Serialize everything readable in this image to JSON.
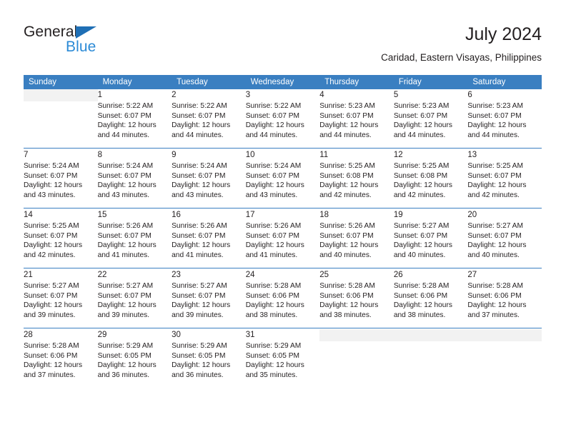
{
  "brand": {
    "name_part1": "General",
    "name_part2": "Blue",
    "triangle_color": "#1f6fb5",
    "blue_color": "#2b8ad6"
  },
  "header": {
    "title": "July 2024",
    "subtitle": "Caridad, Eastern Visayas, Philippines"
  },
  "theme": {
    "header_bg": "#3a7fc1",
    "daynum_bg": "#f2f2f2",
    "text": "#231f20"
  },
  "calendar": {
    "weekday_headers": [
      "Sunday",
      "Monday",
      "Tuesday",
      "Wednesday",
      "Thursday",
      "Friday",
      "Saturday"
    ],
    "weeks": [
      [
        {
          "day": "",
          "sunrise": "",
          "sunset": "",
          "daylight1": "",
          "daylight2": ""
        },
        {
          "day": "1",
          "sunrise": "Sunrise: 5:22 AM",
          "sunset": "Sunset: 6:07 PM",
          "daylight1": "Daylight: 12 hours",
          "daylight2": "and 44 minutes."
        },
        {
          "day": "2",
          "sunrise": "Sunrise: 5:22 AM",
          "sunset": "Sunset: 6:07 PM",
          "daylight1": "Daylight: 12 hours",
          "daylight2": "and 44 minutes."
        },
        {
          "day": "3",
          "sunrise": "Sunrise: 5:22 AM",
          "sunset": "Sunset: 6:07 PM",
          "daylight1": "Daylight: 12 hours",
          "daylight2": "and 44 minutes."
        },
        {
          "day": "4",
          "sunrise": "Sunrise: 5:23 AM",
          "sunset": "Sunset: 6:07 PM",
          "daylight1": "Daylight: 12 hours",
          "daylight2": "and 44 minutes."
        },
        {
          "day": "5",
          "sunrise": "Sunrise: 5:23 AM",
          "sunset": "Sunset: 6:07 PM",
          "daylight1": "Daylight: 12 hours",
          "daylight2": "and 44 minutes."
        },
        {
          "day": "6",
          "sunrise": "Sunrise: 5:23 AM",
          "sunset": "Sunset: 6:07 PM",
          "daylight1": "Daylight: 12 hours",
          "daylight2": "and 44 minutes."
        }
      ],
      [
        {
          "day": "7",
          "sunrise": "Sunrise: 5:24 AM",
          "sunset": "Sunset: 6:07 PM",
          "daylight1": "Daylight: 12 hours",
          "daylight2": "and 43 minutes."
        },
        {
          "day": "8",
          "sunrise": "Sunrise: 5:24 AM",
          "sunset": "Sunset: 6:07 PM",
          "daylight1": "Daylight: 12 hours",
          "daylight2": "and 43 minutes."
        },
        {
          "day": "9",
          "sunrise": "Sunrise: 5:24 AM",
          "sunset": "Sunset: 6:07 PM",
          "daylight1": "Daylight: 12 hours",
          "daylight2": "and 43 minutes."
        },
        {
          "day": "10",
          "sunrise": "Sunrise: 5:24 AM",
          "sunset": "Sunset: 6:07 PM",
          "daylight1": "Daylight: 12 hours",
          "daylight2": "and 43 minutes."
        },
        {
          "day": "11",
          "sunrise": "Sunrise: 5:25 AM",
          "sunset": "Sunset: 6:08 PM",
          "daylight1": "Daylight: 12 hours",
          "daylight2": "and 42 minutes."
        },
        {
          "day": "12",
          "sunrise": "Sunrise: 5:25 AM",
          "sunset": "Sunset: 6:08 PM",
          "daylight1": "Daylight: 12 hours",
          "daylight2": "and 42 minutes."
        },
        {
          "day": "13",
          "sunrise": "Sunrise: 5:25 AM",
          "sunset": "Sunset: 6:07 PM",
          "daylight1": "Daylight: 12 hours",
          "daylight2": "and 42 minutes."
        }
      ],
      [
        {
          "day": "14",
          "sunrise": "Sunrise: 5:25 AM",
          "sunset": "Sunset: 6:07 PM",
          "daylight1": "Daylight: 12 hours",
          "daylight2": "and 42 minutes."
        },
        {
          "day": "15",
          "sunrise": "Sunrise: 5:26 AM",
          "sunset": "Sunset: 6:07 PM",
          "daylight1": "Daylight: 12 hours",
          "daylight2": "and 41 minutes."
        },
        {
          "day": "16",
          "sunrise": "Sunrise: 5:26 AM",
          "sunset": "Sunset: 6:07 PM",
          "daylight1": "Daylight: 12 hours",
          "daylight2": "and 41 minutes."
        },
        {
          "day": "17",
          "sunrise": "Sunrise: 5:26 AM",
          "sunset": "Sunset: 6:07 PM",
          "daylight1": "Daylight: 12 hours",
          "daylight2": "and 41 minutes."
        },
        {
          "day": "18",
          "sunrise": "Sunrise: 5:26 AM",
          "sunset": "Sunset: 6:07 PM",
          "daylight1": "Daylight: 12 hours",
          "daylight2": "and 40 minutes."
        },
        {
          "day": "19",
          "sunrise": "Sunrise: 5:27 AM",
          "sunset": "Sunset: 6:07 PM",
          "daylight1": "Daylight: 12 hours",
          "daylight2": "and 40 minutes."
        },
        {
          "day": "20",
          "sunrise": "Sunrise: 5:27 AM",
          "sunset": "Sunset: 6:07 PM",
          "daylight1": "Daylight: 12 hours",
          "daylight2": "and 40 minutes."
        }
      ],
      [
        {
          "day": "21",
          "sunrise": "Sunrise: 5:27 AM",
          "sunset": "Sunset: 6:07 PM",
          "daylight1": "Daylight: 12 hours",
          "daylight2": "and 39 minutes."
        },
        {
          "day": "22",
          "sunrise": "Sunrise: 5:27 AM",
          "sunset": "Sunset: 6:07 PM",
          "daylight1": "Daylight: 12 hours",
          "daylight2": "and 39 minutes."
        },
        {
          "day": "23",
          "sunrise": "Sunrise: 5:27 AM",
          "sunset": "Sunset: 6:07 PM",
          "daylight1": "Daylight: 12 hours",
          "daylight2": "and 39 minutes."
        },
        {
          "day": "24",
          "sunrise": "Sunrise: 5:28 AM",
          "sunset": "Sunset: 6:06 PM",
          "daylight1": "Daylight: 12 hours",
          "daylight2": "and 38 minutes."
        },
        {
          "day": "25",
          "sunrise": "Sunrise: 5:28 AM",
          "sunset": "Sunset: 6:06 PM",
          "daylight1": "Daylight: 12 hours",
          "daylight2": "and 38 minutes."
        },
        {
          "day": "26",
          "sunrise": "Sunrise: 5:28 AM",
          "sunset": "Sunset: 6:06 PM",
          "daylight1": "Daylight: 12 hours",
          "daylight2": "and 38 minutes."
        },
        {
          "day": "27",
          "sunrise": "Sunrise: 5:28 AM",
          "sunset": "Sunset: 6:06 PM",
          "daylight1": "Daylight: 12 hours",
          "daylight2": "and 37 minutes."
        }
      ],
      [
        {
          "day": "28",
          "sunrise": "Sunrise: 5:28 AM",
          "sunset": "Sunset: 6:06 PM",
          "daylight1": "Daylight: 12 hours",
          "daylight2": "and 37 minutes."
        },
        {
          "day": "29",
          "sunrise": "Sunrise: 5:29 AM",
          "sunset": "Sunset: 6:05 PM",
          "daylight1": "Daylight: 12 hours",
          "daylight2": "and 36 minutes."
        },
        {
          "day": "30",
          "sunrise": "Sunrise: 5:29 AM",
          "sunset": "Sunset: 6:05 PM",
          "daylight1": "Daylight: 12 hours",
          "daylight2": "and 36 minutes."
        },
        {
          "day": "31",
          "sunrise": "Sunrise: 5:29 AM",
          "sunset": "Sunset: 6:05 PM",
          "daylight1": "Daylight: 12 hours",
          "daylight2": "and 35 minutes."
        },
        {
          "day": "",
          "sunrise": "",
          "sunset": "",
          "daylight1": "",
          "daylight2": ""
        },
        {
          "day": "",
          "sunrise": "",
          "sunset": "",
          "daylight1": "",
          "daylight2": ""
        },
        {
          "day": "",
          "sunrise": "",
          "sunset": "",
          "daylight1": "",
          "daylight2": ""
        }
      ]
    ]
  }
}
